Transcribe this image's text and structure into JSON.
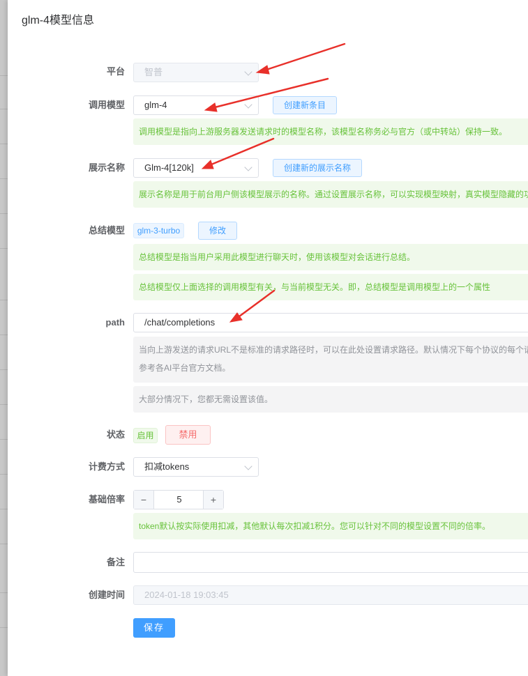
{
  "dialog": {
    "title": "glm-4模型信息"
  },
  "fields": {
    "platform": {
      "label": "平台",
      "value": "智普"
    },
    "model": {
      "label": "调用模型",
      "value": "glm-4",
      "create_button": "创建新条目",
      "tip": "调用模型是指向上游服务器发送请求时的模型名称，该模型名称务必与官方（或中转站）保持一致。"
    },
    "display_name": {
      "label": "展示名称",
      "value": "Glm-4[120k]",
      "create_button": "创建新的展示名称",
      "tip": "展示名称是用于前台用户侧该模型展示的名称。通过设置展示名称，可以实现模型映射，真实模型隐藏的功"
    },
    "summary_model": {
      "label": "总结模型",
      "tag": "glm-3-turbo",
      "edit_button": "修改",
      "tip1": "总结模型是指当用户采用此模型进行聊天时，使用该模型对会话进行总结。",
      "tip2": "总结模型仅上面选择的调用模型有关，与当前模型无关。即，总结模型是调用模型上的一个属性"
    },
    "path": {
      "label": "path",
      "value": "/chat/completions",
      "tip_line1": "当向上游发送的请求URL不是标准的请求路径时，可以在此处设置请求路径。默认情况下每个协议的每个请",
      "tip_line2": "参考各AI平台官方文档。",
      "tip2": "大部分情况下，您都无需设置该值。"
    },
    "status": {
      "label": "状态",
      "enabled_tag": "启用",
      "disable_button": "禁用"
    },
    "billing": {
      "label": "计费方式",
      "value": "扣减tokens"
    },
    "rate": {
      "label": "基础倍率",
      "value": "5",
      "minus": "−",
      "plus": "+",
      "tip": "token默认按实际使用扣减，其他默认每次扣减1积分。您可以针对不同的模型设置不同的倍率。"
    },
    "remark": {
      "label": "备注",
      "value": ""
    },
    "created": {
      "label": "创建时间",
      "value": "2024-01-18 19:03:45"
    }
  },
  "actions": {
    "save": "保存"
  },
  "colors": {
    "primary": "#409eff",
    "success": "#67c23a",
    "danger": "#f56c6c",
    "annotation": "#e8302a"
  }
}
